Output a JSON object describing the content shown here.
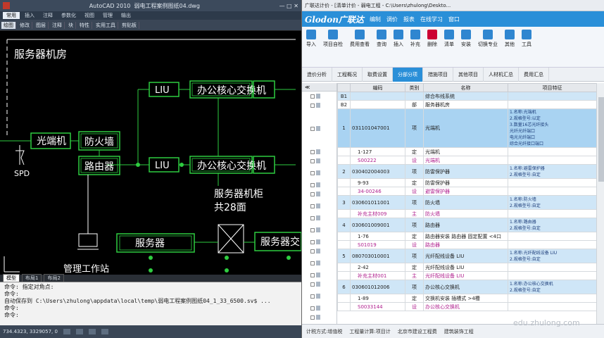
{
  "cad": {
    "title": "AutoCAD 2010",
    "file": "弱电工程案例图纸04.dwg",
    "ribbon_tabs": [
      "常用",
      "插入",
      "注释",
      "参数化",
      "视图",
      "管理",
      "输出"
    ],
    "toolbar_items": [
      "绘图",
      "修改",
      "图层",
      "注释",
      "块",
      "特性",
      "实用工具",
      "剪贴板"
    ],
    "room_label": "服务器机房",
    "blocks": {
      "fiber": "光端机",
      "firewall": "防火墙",
      "router": "路由器",
      "liu_top": "LIU",
      "liu_bottom": "LIU",
      "switch_top": "办公核心交换机",
      "switch_bottom": "办公核心交换机",
      "server": "服务器",
      "server_right": "服务器交",
      "cabinet_line1": "服务器机柜",
      "cabinet_line2": "共28面",
      "spd": "SPD",
      "mgmt": "管理工作站"
    },
    "bottom_tabs": [
      "模型",
      "布局1",
      "布局2"
    ],
    "command_lines": [
      "命令: 指定对角点:",
      "命令:",
      "自动保存到 C:\\Users\\zhulong\\appdata\\local\\temp\\弱电工程案例图纸04_1_33_6500.sv$ ...",
      "命令:",
      "命令:"
    ],
    "coords": "734.4323, 3329057, 0"
  },
  "gld": {
    "title": "广联达计价 - [清单计价 - 弱电工程 - C:\\Users\\zhulong\\Deskto...",
    "logo": "Glodon广联达",
    "menu": [
      "编制",
      "调价",
      "报表",
      "在线学习",
      "窗口"
    ],
    "toolbar": [
      "导入",
      "项目自检",
      "费用查看",
      "查询",
      "插入",
      "补充",
      "删除",
      "清单",
      "安装",
      "切换专业",
      "其他",
      "工具"
    ],
    "tabs": [
      "造价分析",
      "工程概况",
      "取费设置",
      "分部分项",
      "措施项目",
      "其他项目",
      "人材机汇总",
      "费用汇总"
    ],
    "active_tab": "分部分项",
    "headers": [
      "",
      "编码",
      "类别",
      "名称",
      "项目特征"
    ],
    "rows": [
      {
        "no": "B1",
        "code": "",
        "type": "",
        "name": "综合布线系统",
        "feat": "",
        "cls": "blue"
      },
      {
        "no": "B2",
        "code": "",
        "type": "部",
        "name": "服务器机房",
        "feat": "",
        "cls": ""
      },
      {
        "no": "1",
        "code": "031101047001",
        "type": "项",
        "name": "光端机",
        "feat": "1.名称:光端机\n2.规格型号:以定\n3.数量16芯光纤接头\n光纤光纤端口\n电光光纤端口\n综合光纤接口端口",
        "cls": "sel"
      },
      {
        "no": "",
        "code": "1-127",
        "type": "定",
        "name": "光端机",
        "feat": "",
        "cls": ""
      },
      {
        "no": "",
        "code": "S00222",
        "type": "设",
        "name": "光端机",
        "feat": "",
        "cls": "pink"
      },
      {
        "no": "2",
        "code": "030402004003",
        "type": "项",
        "name": "防雷保护器",
        "feat": "1.名称:避雷保护器\n2.规格型号:自定",
        "cls": "blue"
      },
      {
        "no": "",
        "code": "9-93",
        "type": "定",
        "name": "防雷保护器",
        "feat": "",
        "cls": ""
      },
      {
        "no": "",
        "code": "34-00246",
        "type": "设",
        "name": "避雷保护器",
        "feat": "",
        "cls": "pink"
      },
      {
        "no": "3",
        "code": "030601011001",
        "type": "项",
        "name": "防火墙",
        "feat": "1.名称:防火墙\n2.规格型号:自定",
        "cls": "blue"
      },
      {
        "no": "",
        "code": "补充主材009",
        "type": "主",
        "name": "防火墙",
        "feat": "",
        "cls": "pink"
      },
      {
        "no": "4",
        "code": "030601009001",
        "type": "项",
        "name": "路由器",
        "feat": "1.名称:路由器\n2.规格型号:自定",
        "cls": "blue"
      },
      {
        "no": "",
        "code": "1-76",
        "type": "定",
        "name": "路由器安装 路由器 固定配置 <4口",
        "feat": "",
        "cls": ""
      },
      {
        "no": "",
        "code": "S01019",
        "type": "设",
        "name": "路由器",
        "feat": "",
        "cls": "pink"
      },
      {
        "no": "5",
        "code": "080703010001",
        "type": "项",
        "name": "光纤配线设备 LIU",
        "feat": "1.名称:光纤配线设备 LIU\n2.规格型号:自定",
        "cls": "blue"
      },
      {
        "no": "",
        "code": "2-42",
        "type": "定",
        "name": "光纤配线设备 LIU",
        "feat": "",
        "cls": ""
      },
      {
        "no": "",
        "code": "补充主材001",
        "type": "主",
        "name": "光纤配线设备 LIU",
        "feat": "",
        "cls": "pink"
      },
      {
        "no": "6",
        "code": "030601012006",
        "type": "项",
        "name": "办公核心交换机",
        "feat": "1.名称:办公核心交换机\n2.规格型号:自定",
        "cls": "blue"
      },
      {
        "no": "",
        "code": "1-89",
        "type": "定",
        "name": "交换机安装 插槽式 >4槽",
        "feat": "",
        "cls": ""
      },
      {
        "no": "",
        "code": "S0033144",
        "type": "设",
        "name": "办公核心交换机",
        "feat": "",
        "cls": "pink"
      }
    ],
    "status": [
      "计税方式:增值税",
      "工程量计算:项目计",
      "北京市建设工程费",
      "建筑装饰工程"
    ],
    "watermark": "edu.zhulong.com"
  }
}
